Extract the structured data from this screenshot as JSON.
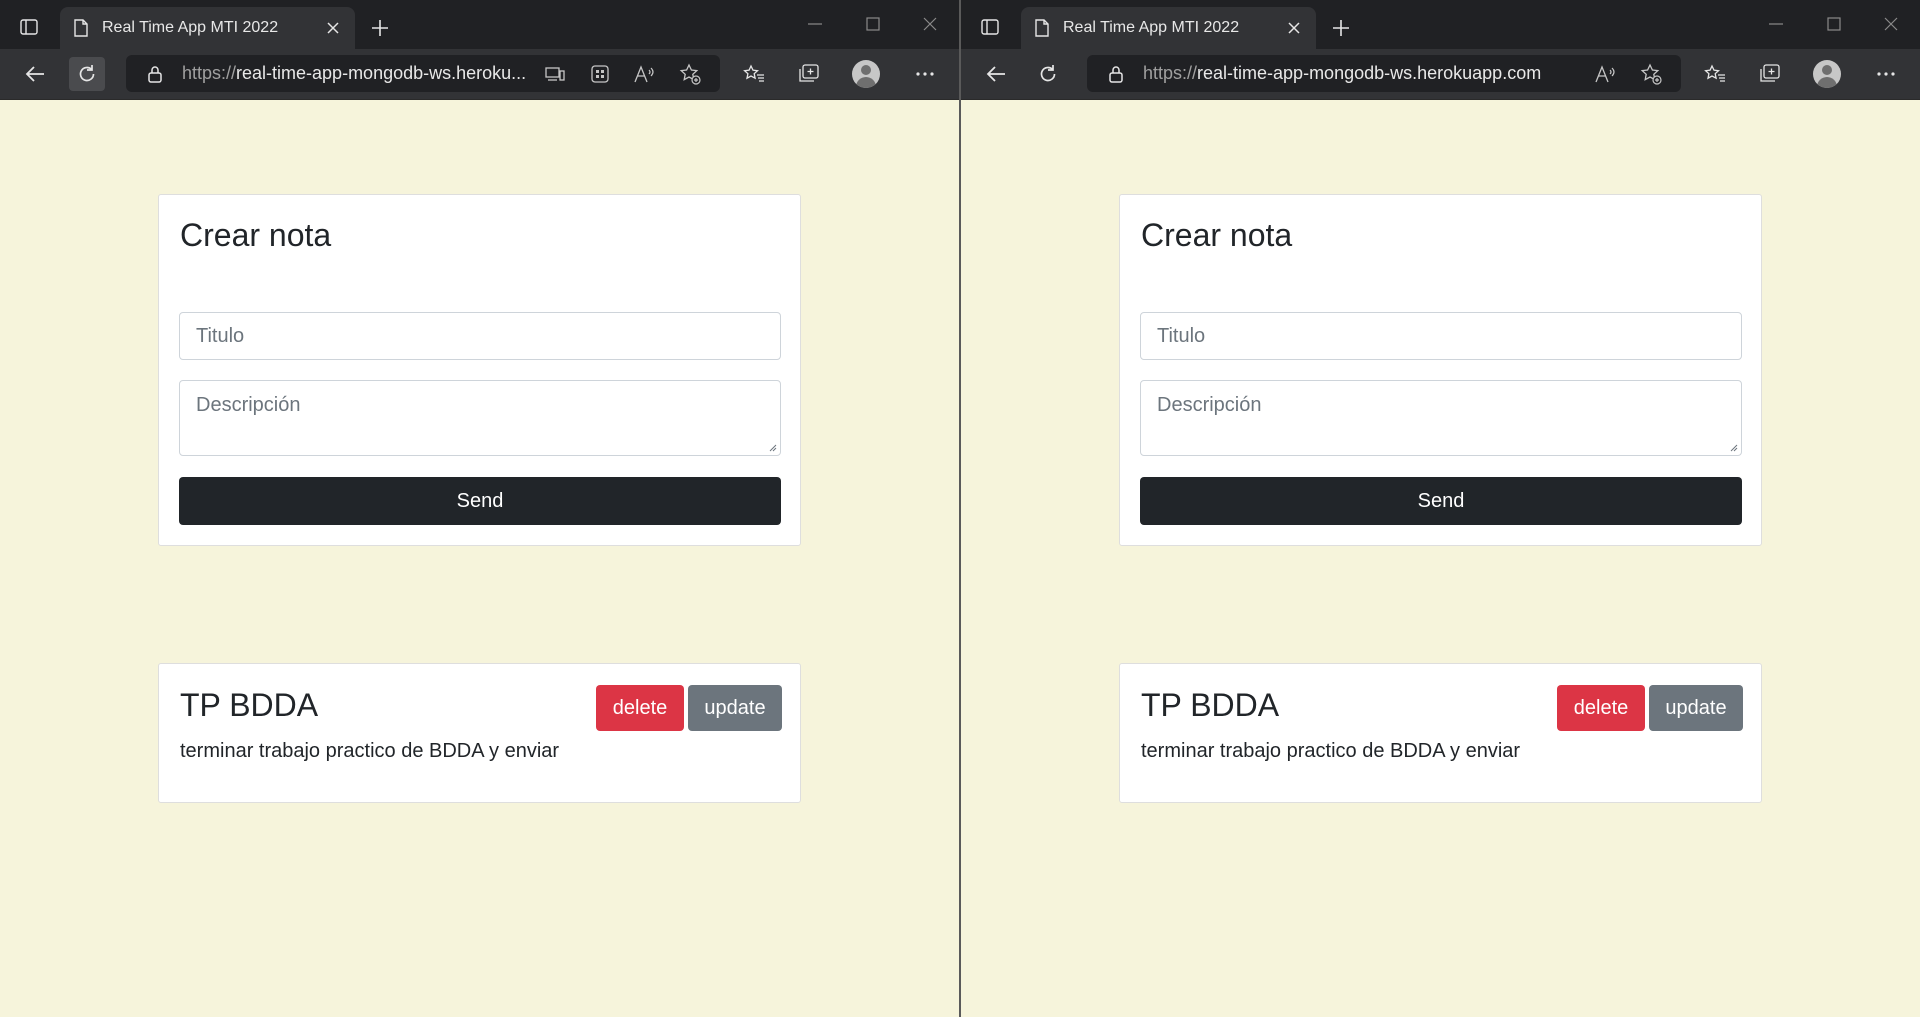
{
  "browser": {
    "tab_title": "Real Time App MTI 2022",
    "url_scheme": "https://",
    "url_host_truncated": "real-time-app-mongodb-ws.heroku...",
    "url_host_full": "real-time-app-mongodb-ws.herokuapp.com"
  },
  "form": {
    "title": "Crear nota",
    "titulo_placeholder": "Titulo",
    "descripcion_placeholder": "Descripción",
    "send_label": "Send"
  },
  "note": {
    "title": "TP BDDA",
    "description": "terminar trabajo practico de BDDA y enviar",
    "delete_label": "delete",
    "update_label": "update"
  },
  "colors": {
    "page_background": "#f6f4db",
    "delete": "#dc3545",
    "update": "#6c757d",
    "send": "#212529"
  },
  "icons": {
    "tab_actions": "tab-actions-icon",
    "page": "page-icon",
    "close": "close-icon",
    "new_tab": "plus-icon",
    "back": "back-arrow-icon",
    "refresh": "refresh-icon",
    "lock": "lock-icon",
    "favorites": "favorites-icon",
    "collections": "collections-icon",
    "profile": "profile-icon",
    "more": "more-icon"
  }
}
